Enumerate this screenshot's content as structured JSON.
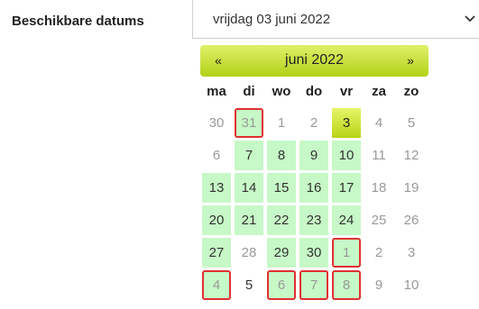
{
  "form": {
    "label": "Beschikbare datums",
    "selected_value": "vrijdag 03 juni 2022",
    "arrow_icon": "chevron-down-icon"
  },
  "calendar": {
    "prev": "«",
    "title": "juni 2022",
    "next": "»",
    "weekdays": [
      "ma",
      "di",
      "wo",
      "do",
      "vr",
      "za",
      "zo"
    ],
    "colors": {
      "header_gradient_top": "#dff06a",
      "header_gradient_bottom": "#b2d117",
      "available_bg": "#c7f8c7",
      "marked_border": "#e03131"
    },
    "weeks": [
      [
        {
          "d": "30",
          "avail": false,
          "other": true,
          "marked": false,
          "selected": false
        },
        {
          "d": "31",
          "avail": true,
          "other": true,
          "marked": true,
          "selected": false
        },
        {
          "d": "1",
          "avail": false,
          "other": true,
          "marked": false,
          "selected": false
        },
        {
          "d": "2",
          "avail": false,
          "other": true,
          "marked": false,
          "selected": false
        },
        {
          "d": "3",
          "avail": true,
          "other": false,
          "marked": false,
          "selected": true
        },
        {
          "d": "4",
          "avail": false,
          "other": true,
          "marked": false,
          "selected": false
        },
        {
          "d": "5",
          "avail": false,
          "other": true,
          "marked": false,
          "selected": false
        }
      ],
      [
        {
          "d": "6",
          "avail": false,
          "other": true,
          "marked": false,
          "selected": false
        },
        {
          "d": "7",
          "avail": true,
          "other": false,
          "marked": false,
          "selected": false
        },
        {
          "d": "8",
          "avail": true,
          "other": false,
          "marked": false,
          "selected": false
        },
        {
          "d": "9",
          "avail": true,
          "other": false,
          "marked": false,
          "selected": false
        },
        {
          "d": "10",
          "avail": true,
          "other": false,
          "marked": false,
          "selected": false
        },
        {
          "d": "11",
          "avail": false,
          "other": true,
          "marked": false,
          "selected": false
        },
        {
          "d": "12",
          "avail": false,
          "other": true,
          "marked": false,
          "selected": false
        }
      ],
      [
        {
          "d": "13",
          "avail": true,
          "other": false,
          "marked": false,
          "selected": false
        },
        {
          "d": "14",
          "avail": true,
          "other": false,
          "marked": false,
          "selected": false
        },
        {
          "d": "15",
          "avail": true,
          "other": false,
          "marked": false,
          "selected": false
        },
        {
          "d": "16",
          "avail": true,
          "other": false,
          "marked": false,
          "selected": false
        },
        {
          "d": "17",
          "avail": true,
          "other": false,
          "marked": false,
          "selected": false
        },
        {
          "d": "18",
          "avail": false,
          "other": true,
          "marked": false,
          "selected": false
        },
        {
          "d": "19",
          "avail": false,
          "other": true,
          "marked": false,
          "selected": false
        }
      ],
      [
        {
          "d": "20",
          "avail": true,
          "other": false,
          "marked": false,
          "selected": false
        },
        {
          "d": "21",
          "avail": true,
          "other": false,
          "marked": false,
          "selected": false
        },
        {
          "d": "22",
          "avail": true,
          "other": false,
          "marked": false,
          "selected": false
        },
        {
          "d": "23",
          "avail": true,
          "other": false,
          "marked": false,
          "selected": false
        },
        {
          "d": "24",
          "avail": true,
          "other": false,
          "marked": false,
          "selected": false
        },
        {
          "d": "25",
          "avail": false,
          "other": true,
          "marked": false,
          "selected": false
        },
        {
          "d": "26",
          "avail": false,
          "other": true,
          "marked": false,
          "selected": false
        }
      ],
      [
        {
          "d": "27",
          "avail": true,
          "other": false,
          "marked": false,
          "selected": false
        },
        {
          "d": "28",
          "avail": false,
          "other": true,
          "marked": false,
          "selected": false
        },
        {
          "d": "29",
          "avail": true,
          "other": false,
          "marked": false,
          "selected": false
        },
        {
          "d": "30",
          "avail": true,
          "other": false,
          "marked": false,
          "selected": false
        },
        {
          "d": "1",
          "avail": true,
          "other": true,
          "marked": true,
          "selected": false
        },
        {
          "d": "2",
          "avail": false,
          "other": true,
          "marked": false,
          "selected": false
        },
        {
          "d": "3",
          "avail": false,
          "other": true,
          "marked": false,
          "selected": false
        }
      ],
      [
        {
          "d": "4",
          "avail": true,
          "other": true,
          "marked": true,
          "selected": false
        },
        {
          "d": "5",
          "avail": false,
          "other": false,
          "marked": false,
          "selected": false
        },
        {
          "d": "6",
          "avail": true,
          "other": true,
          "marked": true,
          "selected": false
        },
        {
          "d": "7",
          "avail": true,
          "other": true,
          "marked": true,
          "selected": false
        },
        {
          "d": "8",
          "avail": true,
          "other": true,
          "marked": true,
          "selected": false
        },
        {
          "d": "9",
          "avail": false,
          "other": true,
          "marked": false,
          "selected": false
        },
        {
          "d": "10",
          "avail": false,
          "other": true,
          "marked": false,
          "selected": false
        }
      ]
    ]
  }
}
